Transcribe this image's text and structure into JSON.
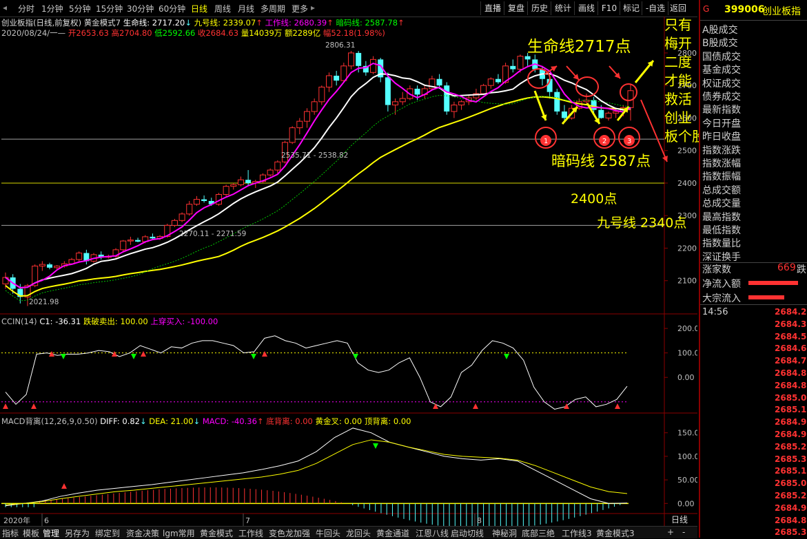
{
  "toolbar": {
    "left_items": [
      "分时",
      "1分钟",
      "5分钟",
      "15分钟",
      "30分钟",
      "60分钟",
      "日线",
      "周线",
      "月线",
      "多周期",
      "更多"
    ],
    "active": "日线",
    "right_items": [
      "直播",
      "复盘",
      "历史",
      "统计",
      "画线",
      "F10",
      "标记",
      "-自选",
      "返回"
    ]
  },
  "info": {
    "line1": "创业板指(日线,前复权)",
    "indicator": "黄金模式7",
    "life_line": "生命线: 2717.20",
    "nine_line": "九号线: 2339.07",
    "work_line": "工作线: 2680.39",
    "dark_horse": "暗码线: 2587.78",
    "date": "2020/08/24/一",
    "open": "开2653.63",
    "high": "高2704.80",
    "low": "低2592.66",
    "close": "收2684.63",
    "volume": "量14039万",
    "amount": "额2289亿",
    "change": "幅52.18(1.98%)"
  },
  "cci_info": {
    "name": "CCIN(14)",
    "c1": "C1: -36.31",
    "sell": "跌破卖出: 100.00",
    "buy": "上穿买入: -100.00"
  },
  "macd_info": {
    "name": "MACD背离(12,26,9,0.50)",
    "diff": "DIFF: 0.82",
    "dea": "DEA: 21.00",
    "macd": "MACD: -40.36",
    "bottom": "底背离: 0.00",
    "golden": "黄金叉: 0.00",
    "top": "顶背离: 0.00"
  },
  "axis": {
    "main_ticks": [
      "2800",
      "2700",
      "2600",
      "2500",
      "2400",
      "2300",
      "2200",
      "2100"
    ],
    "cci_ticks": [
      "200.0",
      "100.0",
      "0.00"
    ],
    "macd_ticks": [
      "150.0",
      "100.0",
      "50.00",
      "0.00"
    ],
    "date_labels": [
      "2020年",
      "6",
      "7",
      "8"
    ],
    "bottom_label": "日线"
  },
  "price_labels": {
    "high": "2806.31",
    "mid": "2535.71 - 2538.82",
    "low_mid": "2270.11 - 2271.59",
    "low": "2021.98"
  },
  "annotations": {
    "life": "生命线2717点",
    "dark": "暗码线 2587点",
    "p2400": "2400点",
    "nine": "九号线 2340点",
    "side": [
      "只有",
      "梅开",
      "二度",
      "才能",
      "救活",
      "创业",
      "板个股"
    ],
    "circles": [
      "1",
      "2",
      "3"
    ]
  },
  "right_panel": {
    "g": "G",
    "code": "399006",
    "name": "创业板指",
    "rows": [
      "A股成交",
      "B股成交",
      "国债成交",
      "基金成交",
      "权证成交",
      "债券成交",
      "最新指数",
      "今日开盘",
      "昨日收盘",
      "指数涨跌",
      "指数涨幅",
      "指数振幅",
      "总成交额",
      "总成交量",
      "最高指数",
      "最低指数",
      "指数量比",
      "深证换手"
    ],
    "up_count_label": "涨家数",
    "up_count": "669",
    "up_count_suffix": "跌",
    "inflow": "净流入额",
    "block": "大宗流入",
    "time": "14:56",
    "ticks": [
      "2684.2",
      "2684.3",
      "2684.5",
      "2684.6",
      "2684.7",
      "2684.8",
      "2684.8",
      "2685.0",
      "2685.1",
      "2684.9",
      "2684.9",
      "2685.2",
      "2685.3",
      "2685.1",
      "2685.0",
      "2685.2",
      "2684.9",
      "2684.8",
      "2685.3"
    ]
  },
  "bottom_tabs": [
    "指标",
    "模板",
    "管理",
    "另存为",
    "绑定到",
    "资金决策",
    "lgm常用",
    "黄金模式",
    "工作线",
    "变色龙加强",
    "牛回头",
    "龙回头",
    "黄金通道",
    "江恩八线",
    "启动切线",
    "神秘洞",
    "底部三绝",
    "工作线3",
    "黄金模式3"
  ],
  "bottom_active": "管理",
  "colors": {
    "up": "#ff3232",
    "down": "#54ffff",
    "life": "#ffffff",
    "nine": "#ffff00",
    "work": "#ff00ff",
    "dark": "#00c800",
    "ann": "#ffff00"
  },
  "chart_data": {
    "type": "candlestick",
    "title": "创业板指(日线,前复权)",
    "ylim": [
      2000,
      2840
    ],
    "candles": [
      [
        2090,
        2125,
        2075,
        2110
      ],
      [
        2110,
        2120,
        2060,
        2075
      ],
      [
        2075,
        2090,
        2030,
        2050
      ],
      [
        2050,
        2090,
        2022,
        2085
      ],
      [
        2085,
        2150,
        2080,
        2145
      ],
      [
        2145,
        2160,
        2130,
        2150
      ],
      [
        2150,
        2155,
        2135,
        2140
      ],
      [
        2140,
        2148,
        2135,
        2145
      ],
      [
        2145,
        2160,
        2140,
        2152
      ],
      [
        2152,
        2170,
        2150,
        2165
      ],
      [
        2165,
        2190,
        2160,
        2185
      ],
      [
        2185,
        2195,
        2150,
        2160
      ],
      [
        2160,
        2185,
        2155,
        2180
      ],
      [
        2180,
        2190,
        2165,
        2172
      ],
      [
        2172,
        2180,
        2168,
        2175
      ],
      [
        2175,
        2200,
        2170,
        2195
      ],
      [
        2195,
        2225,
        2190,
        2222
      ],
      [
        2222,
        2235,
        2210,
        2225
      ],
      [
        2225,
        2232,
        2218,
        2220
      ],
      [
        2220,
        2240,
        2215,
        2235
      ],
      [
        2235,
        2245,
        2225,
        2230
      ],
      [
        2230,
        2240,
        2225,
        2236
      ],
      [
        2236,
        2275,
        2232,
        2270
      ],
      [
        2270,
        2290,
        2265,
        2285
      ],
      [
        2285,
        2310,
        2280,
        2305
      ],
      [
        2305,
        2345,
        2300,
        2335
      ],
      [
        2335,
        2360,
        2330,
        2350
      ],
      [
        2350,
        2362,
        2340,
        2345
      ],
      [
        2345,
        2355,
        2330,
        2335
      ],
      [
        2335,
        2370,
        2330,
        2365
      ],
      [
        2365,
        2395,
        2360,
        2390
      ],
      [
        2390,
        2400,
        2380,
        2395
      ],
      [
        2395,
        2420,
        2390,
        2410
      ],
      [
        2410,
        2440,
        2390,
        2400
      ],
      [
        2400,
        2410,
        2385,
        2405
      ],
      [
        2405,
        2430,
        2400,
        2425
      ],
      [
        2425,
        2445,
        2420,
        2440
      ],
      [
        2440,
        2470,
        2430,
        2465
      ],
      [
        2465,
        2530,
        2460,
        2525
      ],
      [
        2525,
        2575,
        2520,
        2570
      ],
      [
        2570,
        2600,
        2550,
        2590
      ],
      [
        2590,
        2630,
        2570,
        2620
      ],
      [
        2620,
        2660,
        2610,
        2650
      ],
      [
        2650,
        2700,
        2640,
        2695
      ],
      [
        2695,
        2740,
        2680,
        2730
      ],
      [
        2730,
        2745,
        2700,
        2715
      ],
      [
        2715,
        2770,
        2710,
        2760
      ],
      [
        2760,
        2806,
        2750,
        2800
      ],
      [
        2800,
        2806,
        2740,
        2760
      ],
      [
        2760,
        2775,
        2730,
        2740
      ],
      [
        2740,
        2790,
        2735,
        2780
      ],
      [
        2780,
        2785,
        2710,
        2725
      ],
      [
        2725,
        2740,
        2620,
        2640
      ],
      [
        2640,
        2660,
        2610,
        2650
      ],
      [
        2650,
        2680,
        2640,
        2660
      ],
      [
        2660,
        2700,
        2655,
        2690
      ],
      [
        2690,
        2700,
        2655,
        2672
      ],
      [
        2672,
        2700,
        2660,
        2690
      ],
      [
        2690,
        2730,
        2685,
        2720
      ],
      [
        2720,
        2735,
        2690,
        2700
      ],
      [
        2700,
        2710,
        2610,
        2620
      ],
      [
        2620,
        2650,
        2600,
        2640
      ],
      [
        2640,
        2655,
        2625,
        2650
      ],
      [
        2650,
        2670,
        2640,
        2662
      ],
      [
        2662,
        2690,
        2655,
        2675
      ],
      [
        2675,
        2705,
        2670,
        2700
      ],
      [
        2700,
        2725,
        2690,
        2720
      ],
      [
        2720,
        2735,
        2705,
        2710
      ],
      [
        2710,
        2770,
        2705,
        2760
      ],
      [
        2760,
        2780,
        2740,
        2750
      ],
      [
        2750,
        2795,
        2740,
        2790
      ],
      [
        2790,
        2800,
        2760,
        2780
      ],
      [
        2780,
        2795,
        2740,
        2750
      ],
      [
        2750,
        2760,
        2700,
        2720
      ],
      [
        2720,
        2730,
        2660,
        2680
      ],
      [
        2680,
        2690,
        2610,
        2620
      ],
      [
        2620,
        2640,
        2590,
        2600
      ],
      [
        2600,
        2640,
        2595,
        2630
      ],
      [
        2630,
        2660,
        2625,
        2650
      ],
      [
        2650,
        2675,
        2640,
        2655
      ],
      [
        2655,
        2665,
        2615,
        2625
      ],
      [
        2625,
        2640,
        2598,
        2600
      ],
      [
        2600,
        2620,
        2592,
        2615
      ],
      [
        2615,
        2630,
        2600,
        2620
      ],
      [
        2620,
        2640,
        2605,
        2632
      ],
      [
        2632,
        2705,
        2592,
        2684
      ]
    ]
  }
}
